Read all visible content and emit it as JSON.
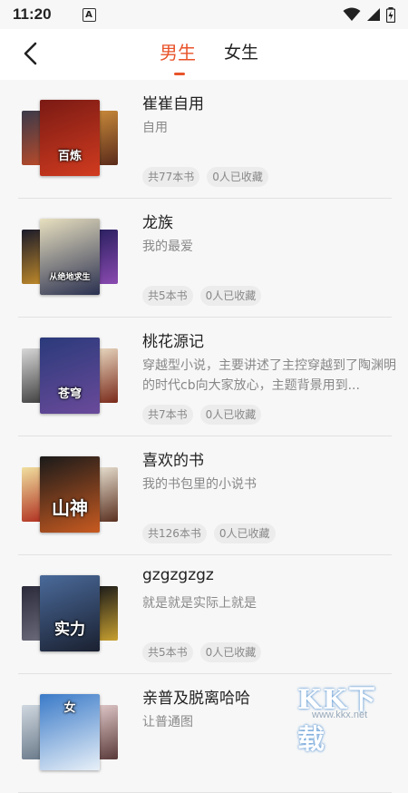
{
  "status_bar": {
    "time": "11:20",
    "a_icon_letter": "A"
  },
  "header": {
    "tabs": [
      {
        "label": "男生",
        "active": true
      },
      {
        "label": "女生",
        "active": false
      }
    ]
  },
  "accent_color": "#e8532a",
  "booklists": [
    {
      "title": "崔崔自用",
      "desc": "自用",
      "book_count": "共77本书",
      "favorites": "0人已收藏",
      "cover_text": "百炼",
      "cover_colors": {
        "front": [
          "#7a1a14",
          "#d13b1f"
        ],
        "left": [
          "#3a3a4a",
          "#b84a2a"
        ],
        "right": [
          "#c88a3a",
          "#5a2a1a"
        ]
      }
    },
    {
      "title": "龙族",
      "desc": "我的最爱",
      "book_count": "共5本书",
      "favorites": "0人已收藏",
      "cover_text": "从绝地求生",
      "cover_colors": {
        "front": [
          "#e8e0c0",
          "#2a3050"
        ],
        "left": [
          "#1a1a2a",
          "#c08a2a"
        ],
        "right": [
          "#2a2060",
          "#8a4ab0"
        ]
      }
    },
    {
      "title": "桃花源记",
      "desc": "穿越型小说，主要讲述了主控穿越到了陶渊明的时代cb向大家放心，主题背景用到...",
      "book_count": "共7本书",
      "favorites": "0人已收藏",
      "cover_text": "苍穹",
      "cover_colors": {
        "front": [
          "#2a3a7a",
          "#6a4a9a"
        ],
        "left": [
          "#d8d8d8",
          "#404040"
        ],
        "right": [
          "#e8d8c0",
          "#7a2a1a"
        ]
      }
    },
    {
      "title": "喜欢的书",
      "desc": "我的书包里的小说书",
      "book_count": "共126本书",
      "favorites": "0人已收藏",
      "cover_text": "山神",
      "cover_colors": {
        "front": [
          "#1a1a1a",
          "#c85a20"
        ],
        "left": [
          "#f0e0a0",
          "#b03020"
        ],
        "right": [
          "#e8e0d0",
          "#5a3020"
        ]
      }
    },
    {
      "title": "gzgzgzgz",
      "desc": "就是就是实际上就是",
      "book_count": "共5本书",
      "favorites": "0人已收藏",
      "cover_text": "实力",
      "cover_colors": {
        "front": [
          "#4a6a9a",
          "#1a2030"
        ],
        "left": [
          "#2a2a3a",
          "#6a6a7a"
        ],
        "right": [
          "#1a1a1a",
          "#c8a030"
        ]
      }
    },
    {
      "title": "亲普及脱离哈哈",
      "desc": "让普通图",
      "book_count": "",
      "favorites": "",
      "cover_text": "女",
      "cover_colors": {
        "front": [
          "#3a7ac8",
          "#e8f0f8"
        ],
        "left": [
          "#d0d8e0",
          "#6a7a8a"
        ],
        "right": [
          "#e0c8c8",
          "#5a3a3a"
        ]
      }
    }
  ],
  "watermark": {
    "text": "KK下载",
    "url": "www.kkx.net"
  }
}
